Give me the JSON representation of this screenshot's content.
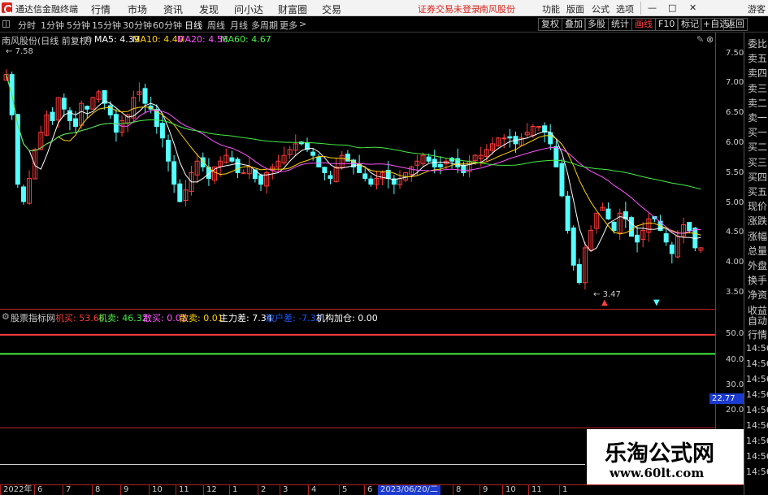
{
  "window": {
    "app_title": "通达信金融终端",
    "menus": [
      "行情",
      "市场",
      "资讯",
      "发现",
      "问小达",
      "财富圈",
      "交易"
    ],
    "status": "证券交易未登录",
    "status_stock": "南风股份",
    "tools": [
      "功能",
      "版面",
      "公式",
      "选项"
    ],
    "guest": "游客"
  },
  "periods": [
    "分时",
    "1分钟",
    "5分钟",
    "15分钟",
    "30分钟",
    "60分钟",
    "日线",
    "周线",
    "月线",
    "多周期",
    "更多"
  ],
  "active_period": "日线",
  "right_buttons": [
    "复权",
    "叠加",
    "多股",
    "统计",
    "画线",
    "F10",
    "标记",
    "+自选",
    "返回"
  ],
  "info": {
    "stock": "南风股份(日线 前复权)",
    "ma5_label": "MA5: 4.39",
    "ma10_label": "MA10: 4.40",
    "ma20_label": "MA20: 4.58",
    "ma60_label": "MA60: 4.67",
    "high_marker": "7.58",
    "low_marker": "3.47"
  },
  "colors": {
    "up": "#ff3b3b",
    "down": "#54ffff",
    "ma5": "#ffffff",
    "ma10": "#ffd200",
    "ma20": "#ff55ff",
    "ma60": "#44ee44",
    "axis": "#b22222"
  },
  "price_axis": [
    "7.50",
    "7.00",
    "6.50",
    "6.00",
    "5.50",
    "5.00",
    "4.50",
    "4.00",
    "3.50"
  ],
  "sub_indicator": {
    "name": "股票指标网",
    "jimai": "机买: 53.66",
    "jimai_c": "机卖: 46.32",
    "sanmai": "散买: 0.01",
    "sanmai_c": "散卖: 0.01",
    "zhulicha": "主力差: 7.34",
    "sanhu": "散户差: -7.33",
    "jigou": "机构加仓: 0.00"
  },
  "sub_axis": [
    "50.00",
    "40.00",
    "30.00",
    "20.00"
  ],
  "sub_current": "22.77",
  "date_ticks": [
    {
      "label": "2022年",
      "pos": 0
    },
    {
      "label": "6",
      "pos": 42
    },
    {
      "label": "7",
      "pos": 77
    },
    {
      "label": "8",
      "pos": 113
    },
    {
      "label": "9",
      "pos": 148
    },
    {
      "label": "10",
      "pos": 183
    },
    {
      "label": "11",
      "pos": 216
    },
    {
      "label": "12",
      "pos": 250
    },
    {
      "label": "1",
      "pos": 282
    },
    {
      "label": "2",
      "pos": 317
    },
    {
      "label": "3",
      "pos": 344
    },
    {
      "label": "4",
      "pos": 379
    },
    {
      "label": "5",
      "pos": 417
    },
    {
      "label": "6",
      "pos": 448
    },
    {
      "label": "7",
      "pos": 525
    },
    {
      "label": "8",
      "pos": 557
    },
    {
      "label": "9",
      "pos": 590
    },
    {
      "label": "10",
      "pos": 618
    },
    {
      "label": "11",
      "pos": 650
    },
    {
      "label": "1",
      "pos": 688
    }
  ],
  "date_highlight": "2023/06/20/二",
  "side_items": [
    "委比",
    "卖五",
    "卖四",
    "卖三",
    "卖二",
    "卖一",
    "买一",
    "买二",
    "买三",
    "买四",
    "买五",
    "现价",
    "涨跌",
    "涨幅",
    "总量",
    "外盘",
    "换手",
    "净资",
    "收益"
  ],
  "side_lower": [
    "自动",
    "行情"
  ],
  "side_times": [
    "14:56",
    "14:56",
    "14:56",
    "14:56",
    "14:56",
    "14:56",
    "14:56",
    "14:56",
    "14:56"
  ],
  "watermark": {
    "title": "乐淘公式网",
    "url": "www.60lt.com"
  },
  "chart_data": {
    "type": "candlestick",
    "ylim": [
      3.3,
      7.8
    ],
    "closes": [
      7.3,
      6.6,
      5.4,
      5.1,
      5.5,
      6.0,
      6.3,
      6.6,
      6.5,
      6.9,
      6.7,
      6.5,
      6.4,
      6.8,
      6.7,
      6.9,
      7.0,
      6.8,
      6.6,
      6.3,
      6.5,
      6.6,
      6.9,
      7.0,
      6.8,
      6.7,
      6.4,
      6.2,
      5.8,
      5.4,
      5.1,
      5.3,
      5.6,
      5.8,
      5.7,
      5.5,
      5.7,
      5.8,
      5.9,
      5.8,
      5.6,
      5.6,
      5.7,
      5.5,
      5.4,
      5.6,
      5.7,
      5.8,
      5.9,
      6.0,
      6.1,
      6.1,
      6.0,
      5.9,
      5.7,
      5.6,
      5.5,
      5.7,
      5.9,
      5.8,
      5.7,
      5.6,
      5.5,
      5.4,
      5.5,
      5.6,
      5.5,
      5.4,
      5.5,
      5.6,
      5.7,
      5.8,
      5.9,
      5.8,
      5.7,
      5.7,
      5.8,
      5.8,
      5.7,
      5.6,
      5.8,
      5.9,
      5.9,
      6.0,
      6.1,
      6.2,
      6.2,
      6.2,
      6.1,
      6.2,
      6.3,
      6.4,
      6.4,
      6.3,
      6.1,
      5.7,
      5.2,
      4.6,
      4.0,
      3.7,
      4.3,
      4.6,
      4.9,
      5.0,
      4.8,
      4.6,
      4.9,
      4.8,
      4.5,
      4.4,
      4.6,
      4.8,
      4.8,
      4.6,
      4.4,
      4.2,
      4.5,
      4.7,
      4.6,
      4.3,
      4.3
    ],
    "series": [
      {
        "name": "MA5"
      },
      {
        "name": "MA10"
      },
      {
        "name": "MA20"
      },
      {
        "name": "MA60"
      }
    ],
    "sub_series": [
      {
        "name": "机买",
        "value": 53.66
      },
      {
        "name": "机卖",
        "value": 46.32
      }
    ]
  }
}
